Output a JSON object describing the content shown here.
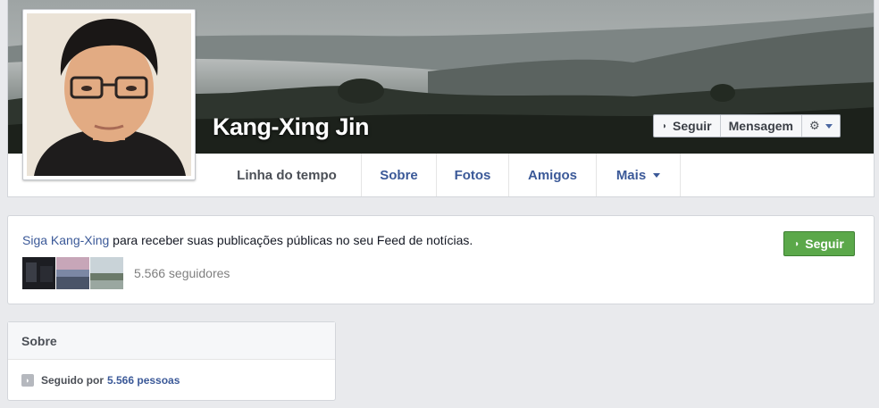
{
  "profile": {
    "name": "Kang-Xing Jin"
  },
  "actions": {
    "follow": "Seguir",
    "message": "Mensagem"
  },
  "tabs": [
    {
      "label": "Linha do tempo"
    },
    {
      "label": "Sobre"
    },
    {
      "label": "Fotos"
    },
    {
      "label": "Amigos"
    },
    {
      "label": "Mais"
    }
  ],
  "follow_card": {
    "link": "Siga Kang-Xing",
    "text": " para receber suas publicações públicas no seu Feed de notícias.",
    "followers": "5.566 seguidores",
    "button": "Seguir"
  },
  "about": {
    "title": "Sobre",
    "followed_prefix": "Seguido por",
    "followed_count": "5.566 pessoas"
  },
  "icons": {
    "follow": "rss-icon",
    "settings": "gear-icon",
    "dropdown": "chevron-down-icon"
  },
  "colors": {
    "brand_link": "#3b5998",
    "follow_button": "#5ba84a",
    "page_bg": "#e9eaed"
  }
}
